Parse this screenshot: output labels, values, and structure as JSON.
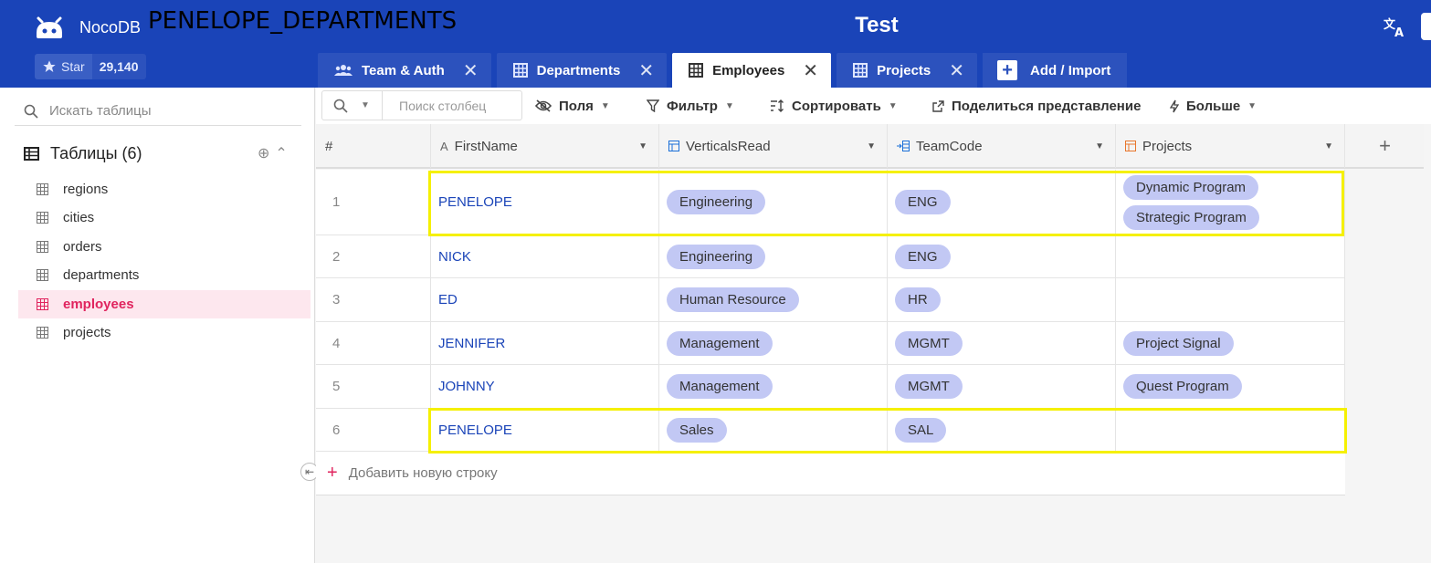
{
  "header": {
    "app_name": "NocoDB",
    "overlay_title": "PENELOPE_DEPARTMENTS",
    "project_title": "Test",
    "star_label": "Star",
    "star_count": "29,140",
    "translate_icon": "translate-icon"
  },
  "tabs": [
    {
      "label": "Team & Auth",
      "icon": "team-icon"
    },
    {
      "label": "Departments",
      "icon": "table-icon"
    },
    {
      "label": "Employees",
      "icon": "table-icon",
      "active": true
    },
    {
      "label": "Projects",
      "icon": "table-icon"
    }
  ],
  "add_import_label": "Add / Import",
  "sidebar": {
    "search_placeholder": "Искать таблицы",
    "tables_header": "Таблицы (6)",
    "items": [
      {
        "label": "regions"
      },
      {
        "label": "cities"
      },
      {
        "label": "orders"
      },
      {
        "label": "departments"
      },
      {
        "label": "employees",
        "active": true
      },
      {
        "label": "projects"
      }
    ]
  },
  "toolbar": {
    "search_placeholder": "Поиск столбец",
    "fields_label": "Поля",
    "filter_label": "Фильтр",
    "sort_label": "Сортировать",
    "share_label": "Поделиться представление",
    "more_label": "Больше"
  },
  "grid": {
    "columns": [
      {
        "label": "#"
      },
      {
        "label": "FirstName",
        "icon": "A"
      },
      {
        "label": "VerticalsRead",
        "icon": "link-icon"
      },
      {
        "label": "TeamCode",
        "icon": "lookup-icon"
      },
      {
        "label": "Projects",
        "icon": "link-icon"
      }
    ],
    "rows": [
      {
        "num": "1",
        "first_name": "PENELOPE",
        "verticals": [
          "Engineering"
        ],
        "team_code": [
          "ENG"
        ],
        "projects": [
          "Dynamic Program",
          "Strategic Program"
        ]
      },
      {
        "num": "2",
        "first_name": "NICK",
        "verticals": [
          "Engineering"
        ],
        "team_code": [
          "ENG"
        ],
        "projects": []
      },
      {
        "num": "3",
        "first_name": "ED",
        "verticals": [
          "Human Resource"
        ],
        "team_code": [
          "HR"
        ],
        "projects": []
      },
      {
        "num": "4",
        "first_name": "JENNIFER",
        "verticals": [
          "Management"
        ],
        "team_code": [
          "MGMT"
        ],
        "projects": [
          "Project Signal"
        ]
      },
      {
        "num": "5",
        "first_name": "JOHNNY",
        "verticals": [
          "Management"
        ],
        "team_code": [
          "MGMT"
        ],
        "projects": [
          "Quest Program"
        ]
      },
      {
        "num": "6",
        "first_name": "PENELOPE",
        "verticals": [
          "Sales"
        ],
        "team_code": [
          "SAL"
        ],
        "projects": []
      }
    ],
    "add_row_label": "Добавить новую строку"
  },
  "colors": {
    "header_bg": "#1a44b8",
    "chip_bg": "#c2c8f4",
    "highlight": "#f5f000",
    "active_item": "#e0245e"
  }
}
